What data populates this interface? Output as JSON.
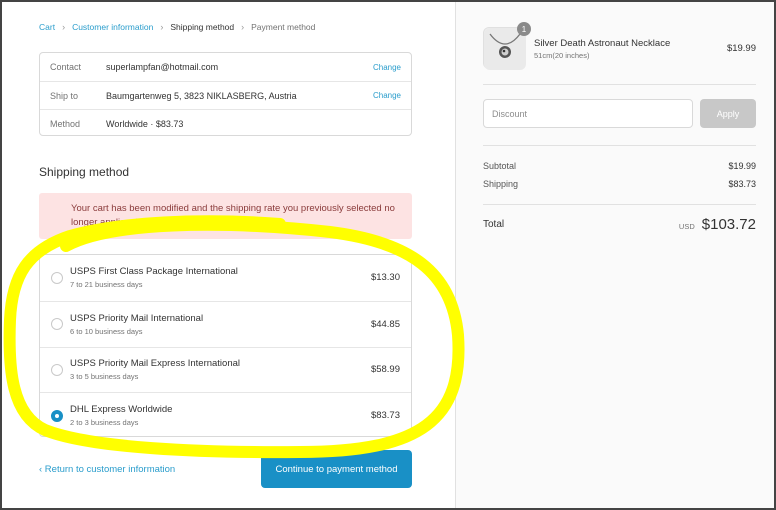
{
  "breadcrumb": {
    "cart": "Cart",
    "customer_information": "Customer information",
    "shipping_method": "Shipping method",
    "payment_method": "Payment method"
  },
  "info": {
    "contact_label": "Contact",
    "contact_value": "superlampfan@hotmail.com",
    "ship_to_label": "Ship to",
    "ship_to_value": "Baumgartenweg 5, 3823 NIKLASBERG, Austria",
    "method_label": "Method",
    "method_value": "Worldwide · $83.73",
    "change_label": "Change"
  },
  "shipping": {
    "title": "Shipping method",
    "alert": "Your cart has been modified and the shipping rate you previously selected no longer applies. Please select a new rate.",
    "rates": [
      {
        "name": "USPS First Class Package International",
        "days": "7 to 21 business days",
        "price": "$13.30",
        "selected": false
      },
      {
        "name": "USPS Priority Mail International",
        "days": "6 to 10 business days",
        "price": "$44.85",
        "selected": false
      },
      {
        "name": "USPS Priority Mail Express International",
        "days": "3 to 5 business days",
        "price": "$58.99",
        "selected": false
      },
      {
        "name": "DHL Express Worldwide",
        "days": "2 to 3 business days",
        "price": "$83.73",
        "selected": true
      }
    ]
  },
  "actions": {
    "back": "‹ Return to customer information",
    "continue": "Continue to payment method"
  },
  "summary": {
    "product_name": "Silver Death Astronaut Necklace",
    "product_variant": "51cm(20 inches)",
    "product_price": "$19.99",
    "quantity": "1",
    "discount_placeholder": "Discount",
    "apply_label": "Apply",
    "subtotal_label": "Subtotal",
    "subtotal_value": "$19.99",
    "shipping_label": "Shipping",
    "shipping_value": "$83.73",
    "total_label": "Total",
    "currency": "USD",
    "total_value": "$103.72"
  },
  "colors": {
    "link": "#2a9dcc",
    "primary_button": "#1990c6",
    "alert_bg": "#fde3e3",
    "highlight": "#ffff00"
  }
}
